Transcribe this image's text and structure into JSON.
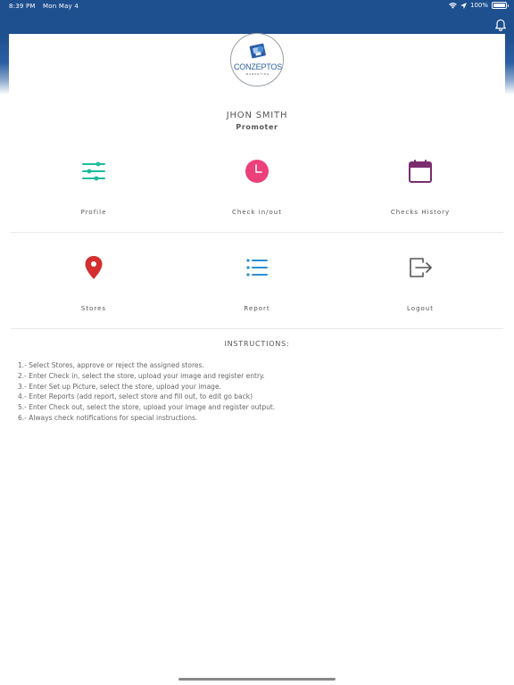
{
  "status_bar": {
    "time": "8:39 PM",
    "date": "Mon May 4",
    "battery": "100%",
    "battery_level": 1.0
  },
  "header": {
    "notification_icon": "bell-icon"
  },
  "logo": {
    "text": "CONZEPTOS",
    "subtext": "MARKETING"
  },
  "user": {
    "name": "JHON SMITH",
    "role": "Promoter"
  },
  "menu": [
    {
      "label": "Profile",
      "icon": "sliders-icon",
      "color": "#1abc9c"
    },
    {
      "label": "Check in/out",
      "icon": "clock-icon",
      "color": "#ec407a"
    },
    {
      "label": "Checks History",
      "icon": "calendar-icon",
      "color": "#7b2d6e"
    },
    {
      "label": "Stores",
      "icon": "map-pin-icon",
      "color": "#d32f2f"
    },
    {
      "label": "Report",
      "icon": "list-icon",
      "color": "#2b8fd0"
    },
    {
      "label": "Logout",
      "icon": "logout-icon",
      "color": "#555555"
    }
  ],
  "instructions": {
    "title": "INSTRUCTIONS:",
    "items": [
      "1.- Select Stores, approve or reject the assigned stores.",
      "2.- Enter Check in, select the store, upload your image and register entry.",
      "3.- Enter Set up Picture, select the store, upload your image.",
      "4.- Enter Reports (add report, select store and fill out, to edit go back)",
      "5.- Enter Check out, select the store, upload your image and register output.",
      "6.- Always check notifications for special instructions."
    ]
  },
  "colors": {
    "header_blue": "#1e4f8f"
  }
}
